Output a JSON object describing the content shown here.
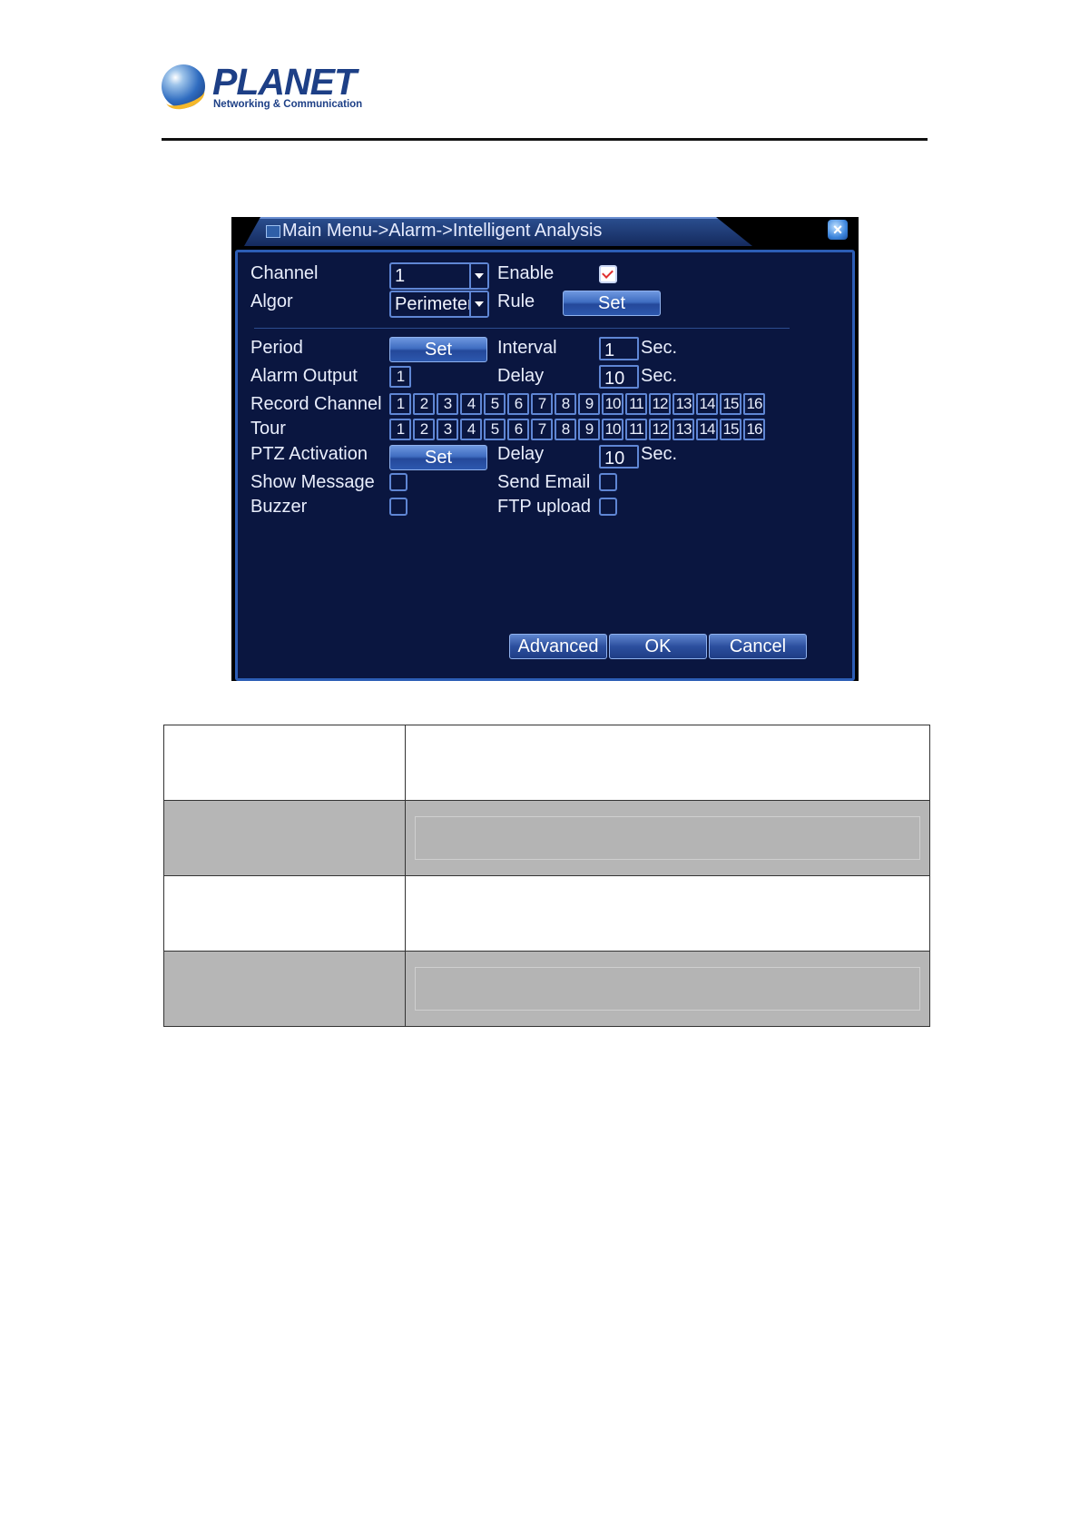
{
  "logo": {
    "brand": "PLANET",
    "tagline": "Networking & Communication"
  },
  "dialog": {
    "title": "Main Menu->Alarm->Intelligent Analysis",
    "close_label": "×",
    "channel": {
      "label": "Channel",
      "value": "1"
    },
    "enable": {
      "label": "Enable",
      "checked": true
    },
    "algor": {
      "label": "Algor",
      "value": "Perimeter"
    },
    "rule": {
      "label": "Rule",
      "button": "Set"
    },
    "period": {
      "label": "Period",
      "button": "Set"
    },
    "interval": {
      "label": "Interval",
      "value": "1",
      "unit": "Sec."
    },
    "alarm_output": {
      "label": "Alarm Output",
      "channels": [
        "1"
      ]
    },
    "delay1": {
      "label": "Delay",
      "value": "10",
      "unit": "Sec."
    },
    "record_channel": {
      "label": "Record Channel",
      "channels": [
        "1",
        "2",
        "3",
        "4",
        "5",
        "6",
        "7",
        "8",
        "9",
        "10",
        "11",
        "12",
        "13",
        "14",
        "15",
        "16"
      ]
    },
    "tour": {
      "label": "Tour",
      "channels": [
        "1",
        "2",
        "3",
        "4",
        "5",
        "6",
        "7",
        "8",
        "9",
        "10",
        "11",
        "12",
        "13",
        "14",
        "15",
        "16"
      ]
    },
    "ptz_activation": {
      "label": "PTZ Activation",
      "button": "Set"
    },
    "delay2": {
      "label": "Delay",
      "value": "10",
      "unit": "Sec."
    },
    "show_message": {
      "label": "Show Message",
      "checked": false
    },
    "send_email": {
      "label": "Send Email",
      "checked": false
    },
    "buzzer": {
      "label": "Buzzer",
      "checked": false
    },
    "ftp_upload": {
      "label": "FTP upload",
      "checked": false
    },
    "buttons": {
      "advanced": "Advanced",
      "ok": "OK",
      "cancel": "Cancel"
    }
  },
  "colors": {
    "panel_bg": "#0a1640",
    "panel_border": "#2c5db5",
    "brand_blue": "#1d3f86"
  }
}
